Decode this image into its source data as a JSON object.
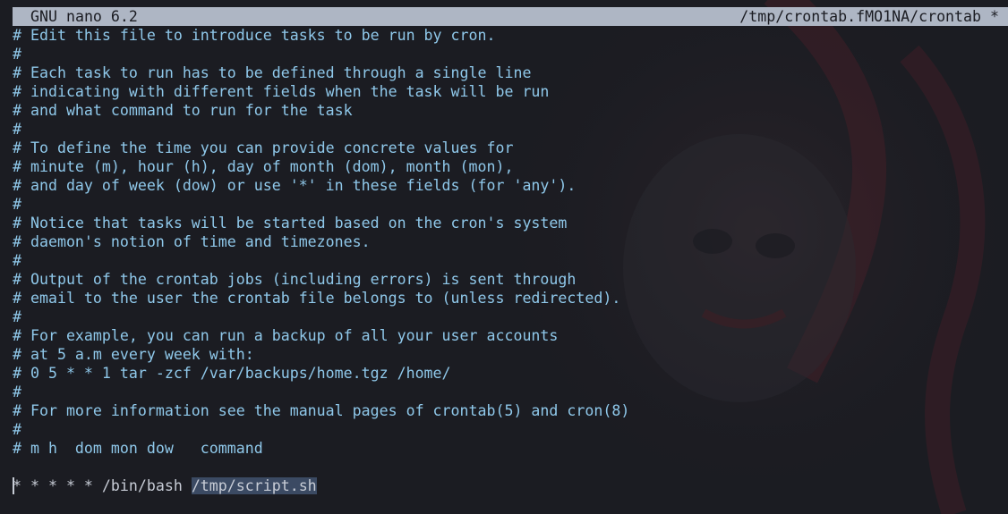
{
  "titlebar": {
    "app": "GNU nano 6.2",
    "file": "/tmp/crontab.fMO1NA/crontab *"
  },
  "colors": {
    "background": "#1b1c22",
    "titlebar": "#aeb6c4",
    "comment": "#8fc8ea",
    "text": "#c7ccd6",
    "selection": "#3b4a63"
  },
  "editor": {
    "lines": [
      "# Edit this file to introduce tasks to be run by cron.",
      "#",
      "# Each task to run has to be defined through a single line",
      "# indicating with different fields when the task will be run",
      "# and what command to run for the task",
      "#",
      "# To define the time you can provide concrete values for",
      "# minute (m), hour (h), day of month (dom), month (mon),",
      "# and day of week (dow) or use '*' in these fields (for 'any').",
      "#",
      "# Notice that tasks will be started based on the cron's system",
      "# daemon's notion of time and timezones.",
      "#",
      "# Output of the crontab jobs (including errors) is sent through",
      "# email to the user the crontab file belongs to (unless redirected).",
      "#",
      "# For example, you can run a backup of all your user accounts",
      "# at 5 a.m every week with:",
      "# 0 5 * * 1 tar -zcf /var/backups/home.tgz /home/",
      "#",
      "# For more information see the manual pages of crontab(5) and cron(8)",
      "#",
      "# m h  dom mon dow   command",
      ""
    ],
    "cron_entry": {
      "prefix": "* * * * * /bin/bash ",
      "selected": "/tmp/script.sh"
    }
  }
}
